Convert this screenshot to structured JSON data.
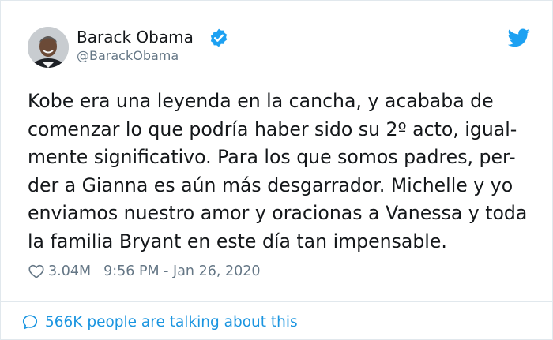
{
  "author": {
    "name": "Barack Obama",
    "handle": "@BarackObama",
    "verified": true
  },
  "tweet": {
    "lines": [
      "Kobe era una leyenda en la cancha, y acababa de",
      "comenzar lo que podría haber sido su 2º acto, igual-",
      "mente significativo. Para los que somos padres, per-",
      "der a Gianna es aún más desgarrador. Michelle y yo",
      "enviamos nuestro amor y oracionas a Vanessa y toda",
      "la familia Bryant en este día tan impensable."
    ]
  },
  "meta": {
    "likes": "3.04M",
    "timestamp": "9:56 PM - Jan 26, 2020"
  },
  "footer": {
    "text": "566K people are talking about this"
  },
  "icons": {
    "verified": "verified-badge-icon",
    "twitter": "twitter-bird-icon",
    "like": "heart-icon",
    "reply": "speech-bubble-icon"
  },
  "colors": {
    "accent": "#1da1f2",
    "link": "#1b95e0",
    "muted": "#657786",
    "text": "#14171a",
    "border": "#e1e8ed"
  }
}
